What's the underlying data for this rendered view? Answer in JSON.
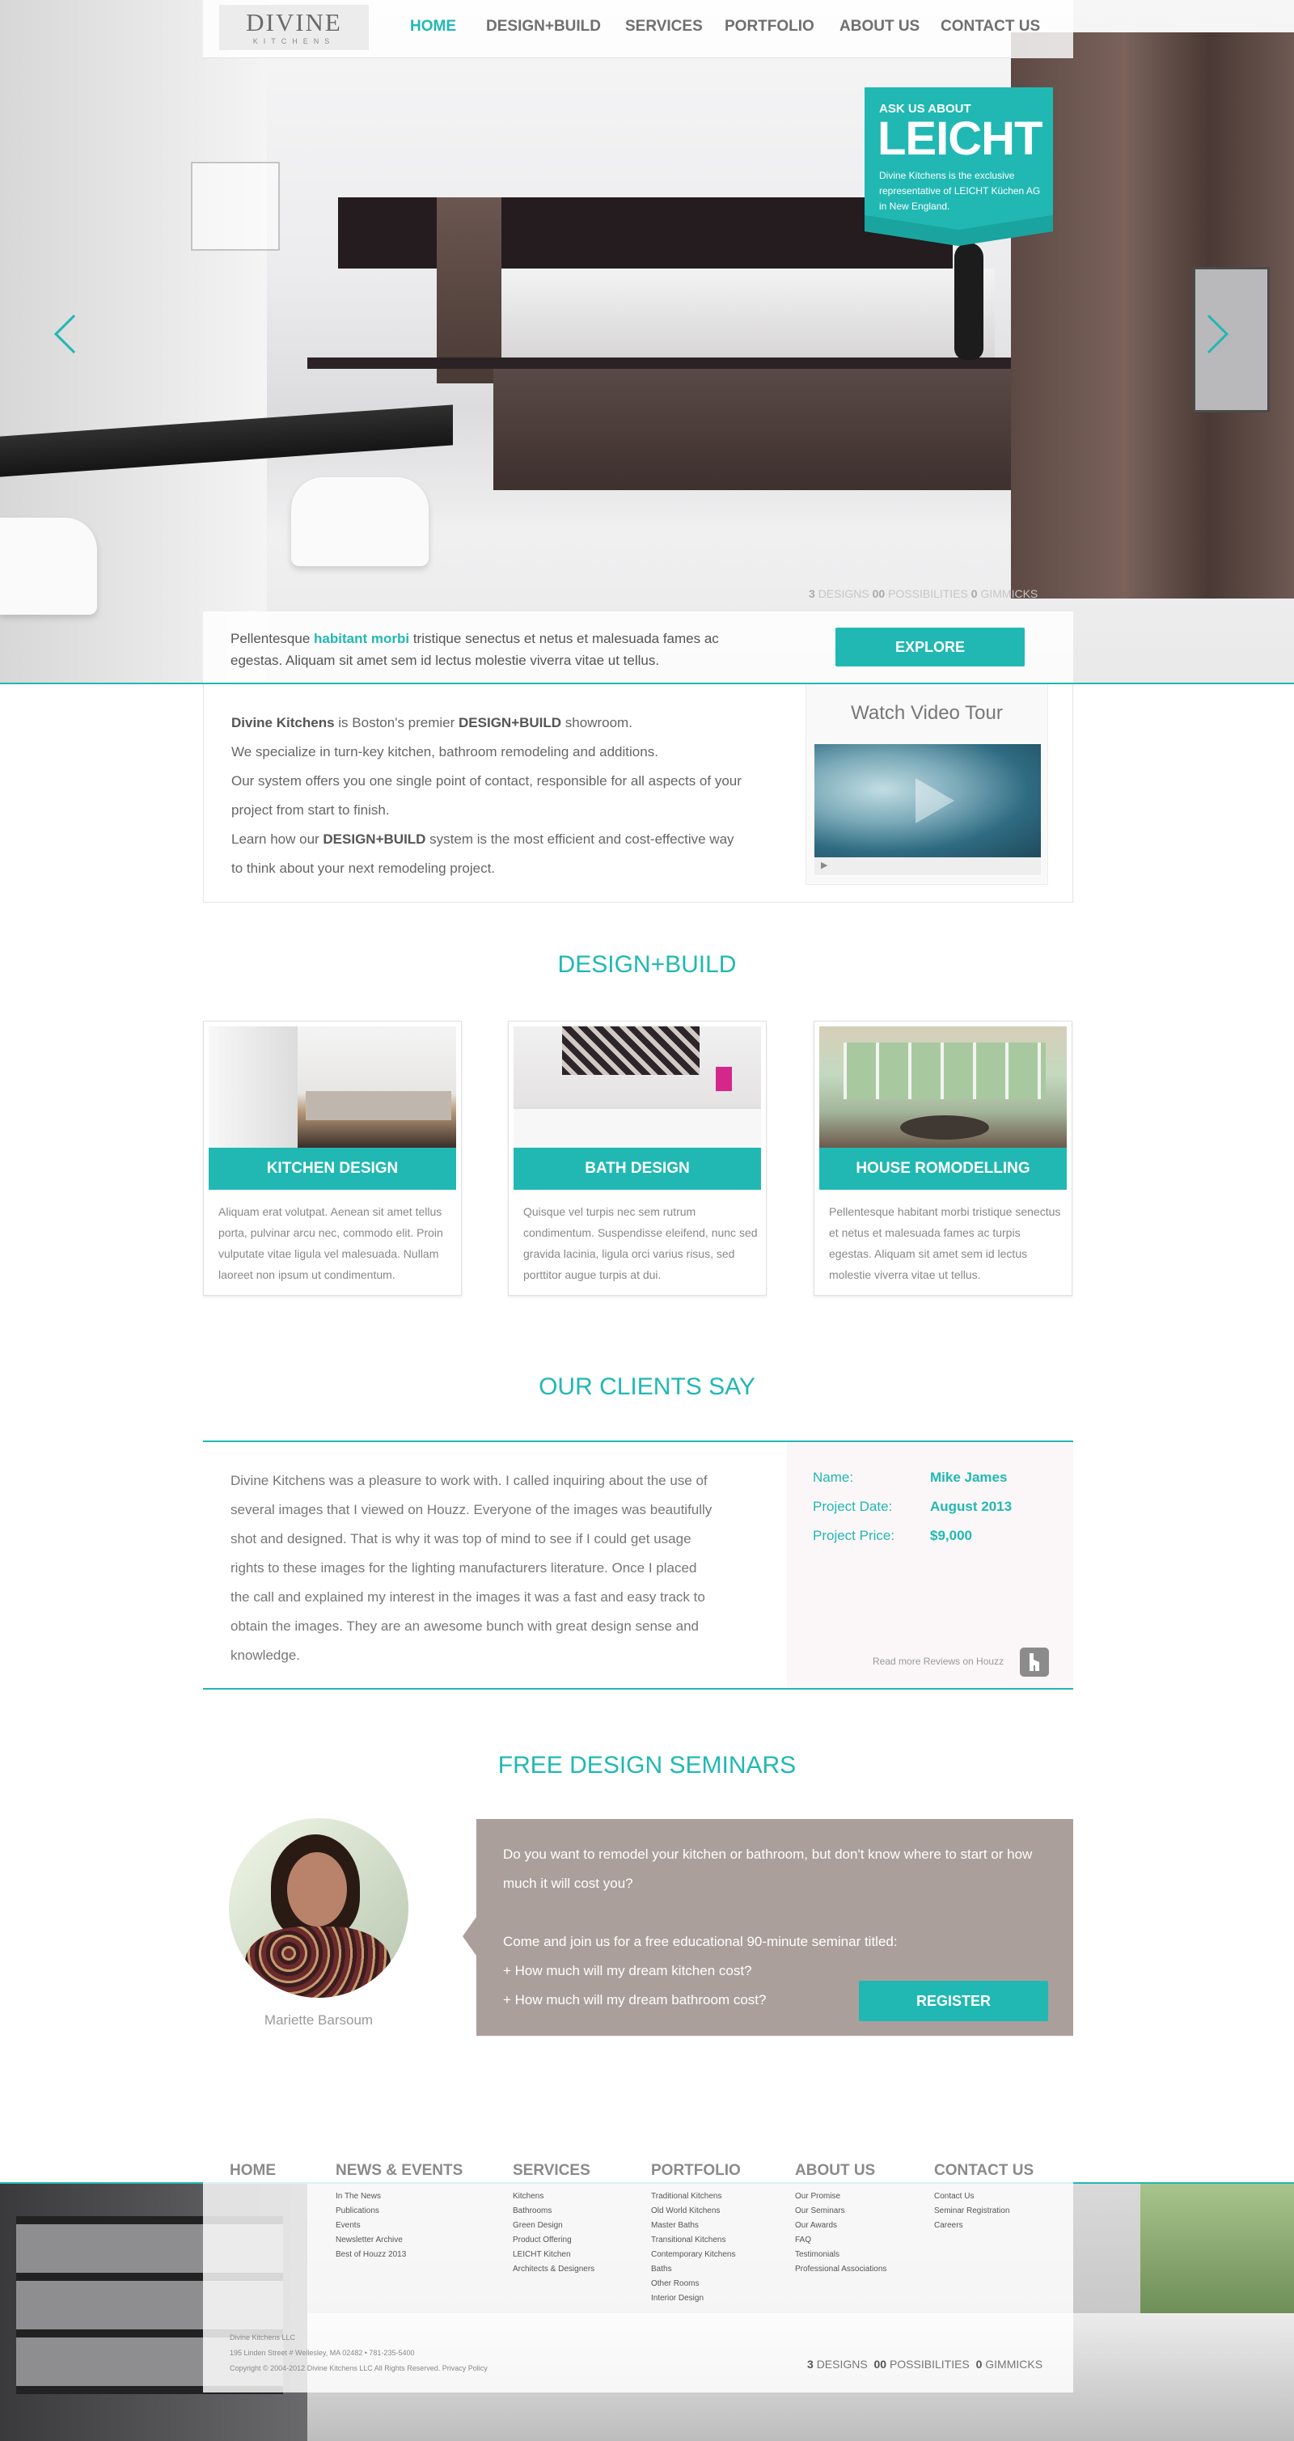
{
  "logo": {
    "name": "DIVINE",
    "sub": "KITCHENS"
  },
  "nav": [
    {
      "label": "HOME",
      "active": true
    },
    {
      "label": "DESIGN+BUILD"
    },
    {
      "label": "SERVICES"
    },
    {
      "label": "PORTFOLIO"
    },
    {
      "label": "ABOUT US"
    },
    {
      "label": "CONTACT US"
    }
  ],
  "badge": {
    "top": "ASK US ABOUT",
    "logo": "LEICHT",
    "text": "Divine Kitchens is the exclusive representative of LEICHT Küchen AG in New England."
  },
  "counter": {
    "n1": "3",
    "l1": "DESIGNS",
    "n2": "00",
    "l2": "POSSIBILITIES",
    "n3": "0",
    "l3": "GIMMICKS"
  },
  "hero_text": {
    "p1": "Pellentesque ",
    "hl": "habitant morbi",
    "p2": " tristique senectus et netus et malesuada fames ac egestas. Aliquam sit amet sem id lectus molestie viverra vitae ut tellus."
  },
  "explore_label": "EXPLORE",
  "intro": {
    "brand": "Divine Kitchens",
    "l1a": " is Boston's premier ",
    "l1b": "DESIGN+BUILD",
    "l1c": " showroom.",
    "l2": "We specialize in turn-key kitchen, bathroom remodeling and additions.",
    "l3": "Our system offers you one single point of contact, responsible for all aspects of your project from start to finish.",
    "l4a": "Learn how our ",
    "l4b": "DESIGN+BUILD",
    "l4c": " system is the most efficient and cost-effective way to think about your next remodeling project."
  },
  "video": {
    "title": "Watch Video Tour",
    "play": "▶"
  },
  "design_build_title": "DESIGN+BUILD",
  "cards": [
    {
      "title": "KITCHEN DESIGN",
      "text": "Aliquam erat volutpat. Aenean sit amet tellus porta, pulvinar arcu nec, commodo elit. Proin vulputate vitae ligula vel malesuada. Nullam laoreet non ipsum ut condimentum."
    },
    {
      "title": "BATH DESIGN",
      "text": "Quisque vel turpis nec sem rutrum condimentum. Suspendisse eleifend, nunc sed gravida lacinia, ligula orci varius risus, sed porttitor augue turpis at dui."
    },
    {
      "title": "HOUSE ROMODELLING",
      "text": "Pellentesque habitant morbi tristique senectus et netus et malesuada fames ac turpis egestas. Aliquam sit amet sem id lectus molestie viverra vitae ut tellus."
    }
  ],
  "clients_title": "OUR CLIENTS SAY",
  "testimonial": {
    "quote": "Divine Kitchens was a pleasure to work with. I called inquiring about the use of several images that I viewed on Houzz. Everyone of the images was beautifully shot and designed. That is why it was top of mind to see if I could get usage rights to these images for the lighting manufacturers literature. Once I placed the call and explained my interest in the images it was a fast and easy track to obtain the images. They are an awesome bunch with great design sense and knowledge.",
    "name_label": "Name:",
    "name": "Mike James",
    "date_label": "Project Date:",
    "date": "August 2013",
    "price_label": "Project Price:",
    "price": "$9,000",
    "houzz": "Read more Reviews on Houzz"
  },
  "seminars_title": "FREE DESIGN SEMINARS",
  "presenter": "Mariette Barsoum",
  "seminar": {
    "p1": "Do you want to remodel your kitchen or bathroom, but don't know where to start or how much it will cost you?",
    "p2": "Come and join us for a free educational 90-minute seminar titled:",
    "q1": "+ How much will my dream kitchen cost?",
    "q2": "+ How much will my dream bathroom cost?",
    "register": "REGISTER"
  },
  "footer": {
    "cols": [
      {
        "head": "HOME",
        "links": []
      },
      {
        "head": "NEWS & EVENTS",
        "links": [
          "In The News",
          "Publications",
          "Events",
          "Newsletter Archive",
          "Best of Houzz 2013"
        ]
      },
      {
        "head": "SERVICES",
        "links": [
          "Kitchens",
          "Bathrooms",
          "Green Design",
          "Product Offering",
          "LEICHT Kitchen",
          "Architects & Designers"
        ]
      },
      {
        "head": "PORTFOLIO",
        "links": [
          "Traditional Kitchens",
          "Old World Kitchens",
          "Master Baths",
          "Transitional Kitchens",
          "Contemporary Kitchens",
          "Baths",
          "Other Rooms",
          "Interior Design"
        ]
      },
      {
        "head": "ABOUT US",
        "links": [
          "Our Promise",
          "Our Seminars",
          "Our Awards",
          "FAQ",
          "Testimonials",
          "Professional Associations"
        ]
      },
      {
        "head": "CONTACT US",
        "links": [
          "Contact Us",
          "Seminar Registration",
          "Careers"
        ]
      }
    ],
    "copy1": "Divine Kitchens LLC",
    "copy2": "195 Linden Street # Wellesley, MA 02482 • 781-235-5400",
    "copy3": "Copyright © 2004-2012 Divine Kitchens LLC All Rights Reserved. Privacy Policy"
  }
}
